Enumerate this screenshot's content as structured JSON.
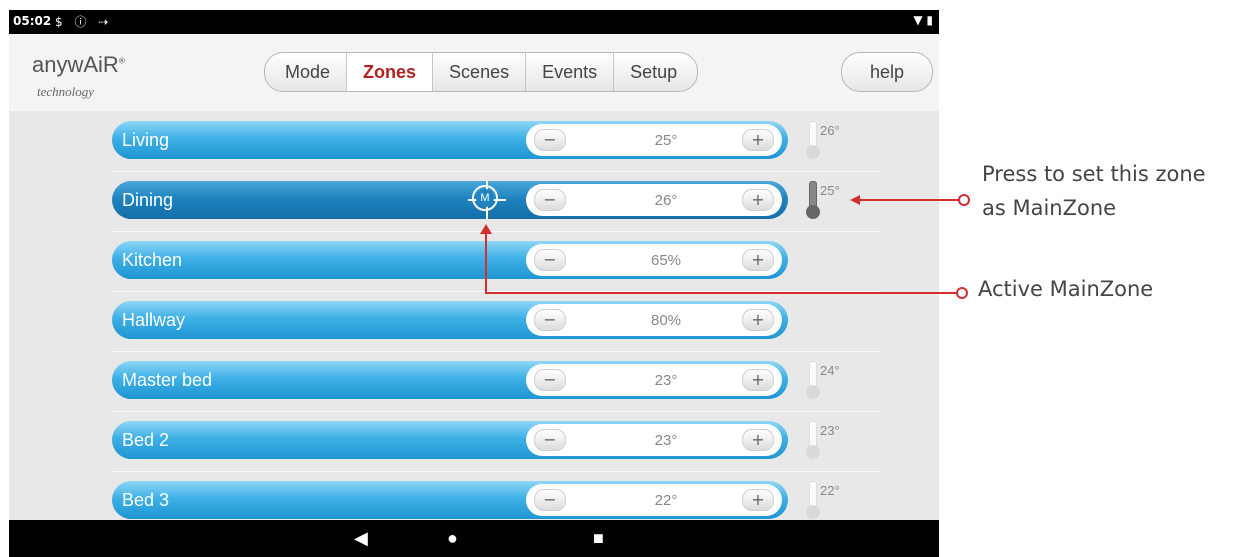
{
  "status_bar": {
    "time": "05:02",
    "icons": "$ ⓘ ⇢",
    "right": "▼ ▮"
  },
  "app": {
    "logo_main": "anywAiR",
    "logo_registered": "®",
    "logo_sub": "technology"
  },
  "tabs": [
    {
      "label": "Mode"
    },
    {
      "label": "Zones",
      "active": true
    },
    {
      "label": "Scenes"
    },
    {
      "label": "Events"
    },
    {
      "label": "Setup"
    }
  ],
  "help_label": "help",
  "zones": [
    {
      "name": "Living",
      "setpoint": "25°",
      "temp": "26°"
    },
    {
      "name": "Dining",
      "setpoint": "26°",
      "temp": "25°",
      "main_badge": "M"
    },
    {
      "name": "Kitchen",
      "setpoint": "65%"
    },
    {
      "name": "Hallway",
      "setpoint": "80%"
    },
    {
      "name": "Master bed",
      "setpoint": "23°",
      "temp": "24°"
    },
    {
      "name": "Bed 2",
      "setpoint": "23°",
      "temp": "23°"
    },
    {
      "name": "Bed 3",
      "setpoint": "22°",
      "temp": "22°"
    }
  ],
  "stepper": {
    "minus": "−",
    "plus": "+"
  },
  "nav": {
    "back": "◀",
    "home": "●",
    "recents": "■"
  },
  "callouts": {
    "set_main_line1": "Press to set this zone",
    "set_main_line2": "as MainZone",
    "active_main": "Active MainZone"
  },
  "colors": {
    "accent": "#b22222",
    "zone_bar": "#3fb0e6",
    "annotation": "#d32f2f"
  }
}
